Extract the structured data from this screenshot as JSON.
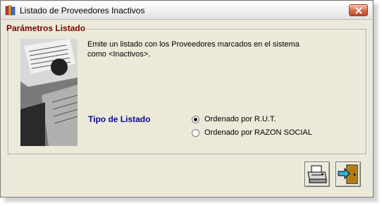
{
  "window": {
    "title": "Listado de Proveedores Inactivos"
  },
  "group": {
    "label": "Parámetros Listado",
    "description": "Emite un listado con los Proveedores marcados en el sistema como <Inactivos>.",
    "list_type_label": "Tipo de Listado",
    "options": [
      {
        "label": "Ordenado por R.U.T.",
        "selected": true
      },
      {
        "label": "Ordenado por RAZON SOCIAL",
        "selected": false
      }
    ]
  },
  "toolbar": {
    "print_icon": "printer-icon",
    "exit_icon": "exit-door-icon"
  }
}
